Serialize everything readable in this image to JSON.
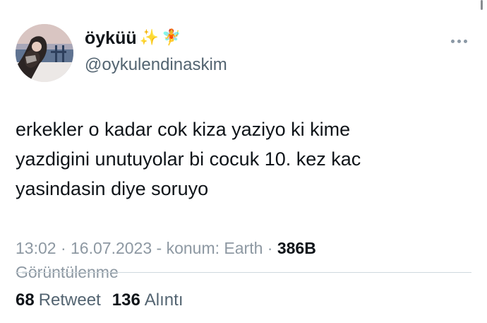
{
  "tweet": {
    "author": {
      "display_name": "öyküü",
      "emoji_sparkle": "✨",
      "emoji_fairy": "🧚",
      "handle": "@oykulendinaskim"
    },
    "text_lines": [
      "erkekler o kadar cok kiza yaziyo ki kime",
      "yazdigini unutuyolar bi cocuk 10. kez kac",
      "yasindasin diye soruyo"
    ],
    "time": "13:02",
    "date": "16.07.2023",
    "location": "konum: Earth",
    "views_count": "386B",
    "views_label": "Görüntülenme",
    "retweets_count": "68",
    "retweets_label": "Retweet",
    "quotes_count": "136",
    "quotes_label": "Alıntı"
  },
  "icons": {
    "more": "more-horizontal-icon",
    "avatar": "profile-photo"
  }
}
